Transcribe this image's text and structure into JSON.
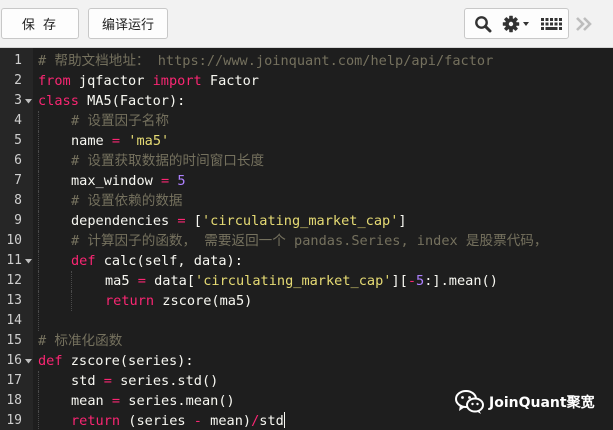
{
  "toolbar": {
    "save_label": "保 存",
    "run_label": "编译运行",
    "icons": [
      "search-icon",
      "gear-icon",
      "keyboard-icon",
      "collapse-panel-icon"
    ]
  },
  "editor": {
    "theme": "dark",
    "colors": {
      "background": "#1e1e1e",
      "keyword": "#f92672",
      "comment": "#75715e",
      "string": "#e6db74",
      "number": "#ae81ff",
      "text": "#f8f8f2"
    },
    "lines": [
      {
        "n": "1",
        "t": {
          "c1": "# 帮助文档地址： https://www.joinquant.com/help/api/factor"
        }
      },
      {
        "n": "2",
        "t": {
          "k1": "from",
          "a1": " jqfactor ",
          "k2": "import",
          "a2": " Factor"
        }
      },
      {
        "n": "3",
        "t": {
          "k1": "class",
          "a1": " MA5(Factor):"
        }
      },
      {
        "n": "4",
        "t": {
          "c1": "# 设置因子名称"
        }
      },
      {
        "n": "5",
        "t": {
          "a1": "name ",
          "o1": "=",
          "a2": " ",
          "s1": "'ma5'"
        }
      },
      {
        "n": "6",
        "t": {
          "c1": "# 设置获取数据的时间窗口长度"
        }
      },
      {
        "n": "7",
        "t": {
          "a1": "max_window ",
          "o1": "=",
          "a2": " ",
          "num1": "5"
        }
      },
      {
        "n": "8",
        "t": {
          "c1": "# 设置依赖的数据"
        }
      },
      {
        "n": "9",
        "t": {
          "a1": "dependencies ",
          "o1": "=",
          "a2": " [",
          "s1": "'circulating_market_cap'",
          "a3": "]"
        }
      },
      {
        "n": "10",
        "t": {
          "c1": "# 计算因子的函数， 需要返回一个 pandas.Series, index 是股票代码，"
        }
      },
      {
        "n": "11",
        "t": {
          "k1": "def",
          "a1": " calc(self, data):"
        }
      },
      {
        "n": "12",
        "t": {
          "a1": "ma5 ",
          "o1": "=",
          "a2": " data[",
          "s1": "'circulating_market_cap'",
          "a3": "][",
          "o2": "-",
          "num1": "5",
          "a4": ":].mean()"
        }
      },
      {
        "n": "13",
        "t": {
          "k1": "return",
          "a1": " zscore(ma5)"
        }
      },
      {
        "n": "14",
        "t": {}
      },
      {
        "n": "15",
        "t": {
          "c1": "# 标准化函数"
        }
      },
      {
        "n": "16",
        "t": {
          "k1": "def",
          "a1": " zscore(series):"
        }
      },
      {
        "n": "17",
        "t": {
          "a1": "std ",
          "o1": "=",
          "a2": " series.std()"
        }
      },
      {
        "n": "18",
        "t": {
          "a1": "mean ",
          "o1": "=",
          "a2": " series.mean()"
        }
      },
      {
        "n": "19",
        "t": {
          "k1": "return",
          "a1": " (series ",
          "o1": "-",
          "a2": " mean)",
          "o2": "/",
          "a3": "std"
        }
      }
    ]
  },
  "watermark": {
    "text": "JoinQuant聚宽",
    "icon": "wechat-logo-icon"
  }
}
